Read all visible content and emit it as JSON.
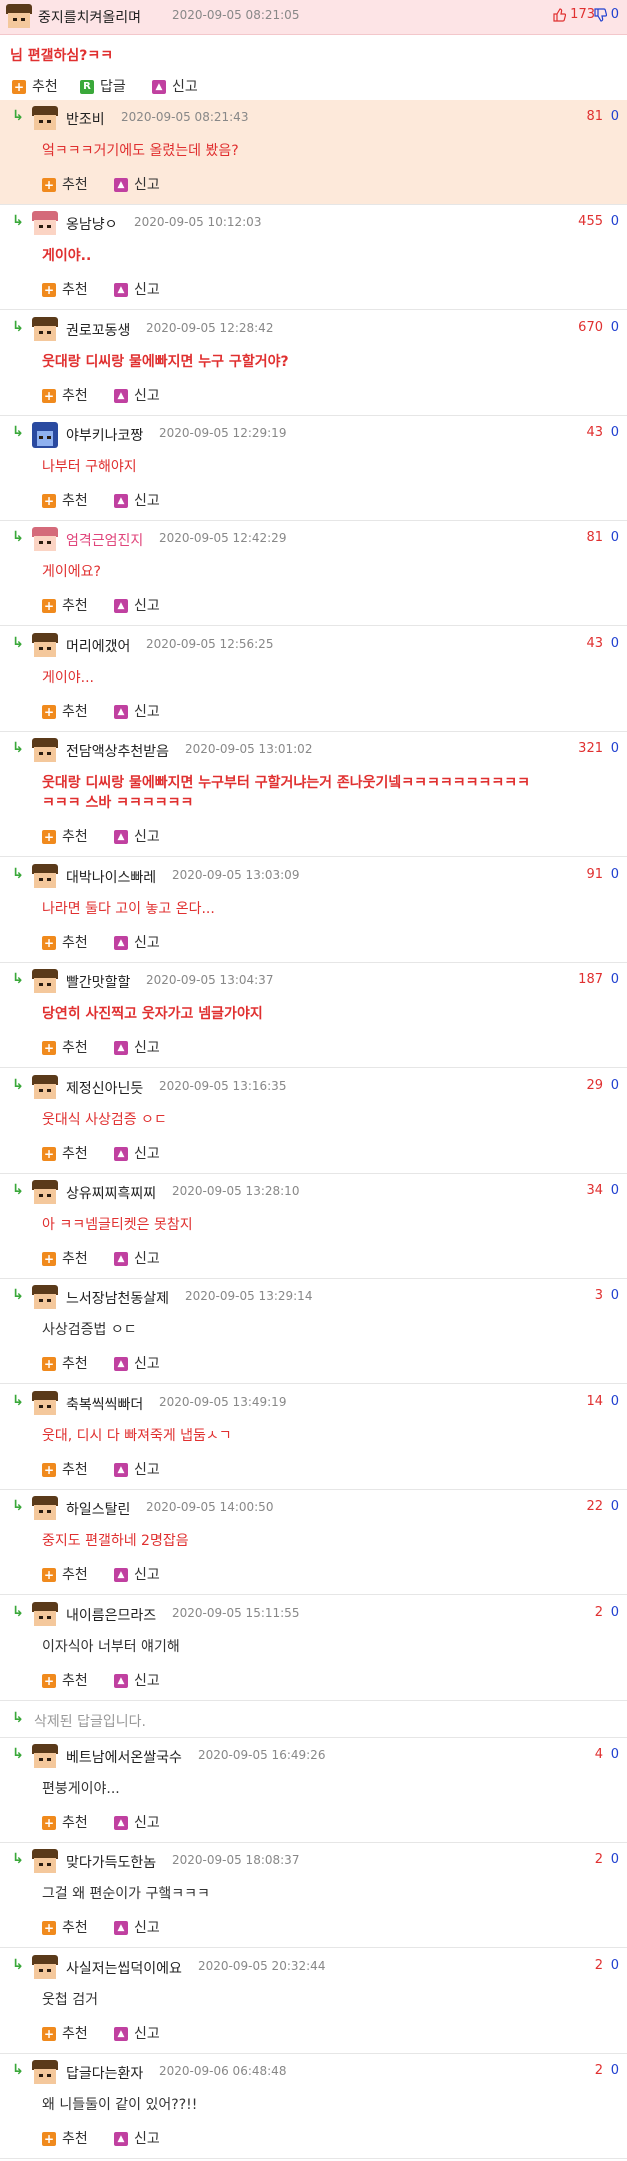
{
  "post": {
    "nick": "중지를치켜올리며",
    "time": "2020-09-05 08:21:05",
    "like_count": "173",
    "dislike_count": "0",
    "text": "님 편갤하심?ㅋㅋ",
    "actions": {
      "recommend": "추천",
      "reply": "답글",
      "report": "신고"
    }
  },
  "comment_actions": {
    "recommend": "추천",
    "report": "신고"
  },
  "comments": [
    {
      "nick": "반조비",
      "time": "2020-09-05 08:21:43",
      "count": "81",
      "zero": "0",
      "text": "엌ㅋㅋㅋ거기에도 올렸는데 봤음?",
      "style": "red"
    },
    {
      "nick": "옹남냥ㅇ",
      "time": "2020-09-05 10:12:03",
      "count": "455",
      "zero": "0",
      "text": "게이야..",
      "style": "redbold"
    },
    {
      "nick": "권로꼬동생",
      "time": "2020-09-05 12:28:42",
      "count": "670",
      "zero": "0",
      "text": "웃대랑 디씨랑 물에빠지면 누구 구할거야?",
      "style": "redbold"
    },
    {
      "nick": "야부키나코짱",
      "time": "2020-09-05 12:29:19",
      "count": "43",
      "zero": "0",
      "text": "나부터 구해야지",
      "style": "red"
    },
    {
      "nick": "엄격근엄진지",
      "time": "2020-09-05 12:42:29",
      "count": "81",
      "zero": "0",
      "text": "게이에요?",
      "style": "red"
    },
    {
      "nick": "머리에갰어",
      "time": "2020-09-05 12:56:25",
      "count": "43",
      "zero": "0",
      "text": "게이야...",
      "style": "red"
    },
    {
      "nick": "전담액상추천받음",
      "time": "2020-09-05 13:01:02",
      "count": "321",
      "zero": "0",
      "text": "웃대랑 디씨랑 물에빠지면 누구부터 구할거냐는거 존나웃기넼ㅋㅋㅋㅋㅋㅋㅋㅋㅋㅋ",
      "text2": "ㅋㅋㅋ 스바 ㅋㅋㅋㅋㅋㅋ",
      "style": "redbold"
    },
    {
      "nick": "대박나이스빠레",
      "time": "2020-09-05 13:03:09",
      "count": "91",
      "zero": "0",
      "text": "나라면 둘다 고이 놓고 온다...",
      "style": "red"
    },
    {
      "nick": "빨간맛할할",
      "time": "2020-09-05 13:04:37",
      "count": "187",
      "zero": "0",
      "text": "당연히 사진찍고 웃자가고 넴글가야지",
      "style": "redbold"
    },
    {
      "nick": "제정신아닌듯",
      "time": "2020-09-05 13:16:35",
      "count": "29",
      "zero": "0",
      "text": "웃대식 사상검증 ㅇㄷ",
      "style": "red"
    },
    {
      "nick": "상유찌찌흑찌찌",
      "time": "2020-09-05 13:28:10",
      "count": "34",
      "zero": "0",
      "text": "아 ㅋㅋ넴글티켓은 못참지",
      "style": "red"
    },
    {
      "nick": "느서장남천동살제",
      "time": "2020-09-05 13:29:14",
      "count": "3",
      "zero": "0",
      "text": "사상검증법 ㅇㄷ",
      "style": "dark"
    },
    {
      "nick": "축복씩씩빠더",
      "time": "2020-09-05 13:49:19",
      "count": "14",
      "zero": "0",
      "text": "웃대, 디시 다 빠져죽게 냅둠ㅅㄱ",
      "style": "red"
    },
    {
      "nick": "하일스탈린",
      "time": "2020-09-05 14:00:50",
      "count": "22",
      "zero": "0",
      "text": "중지도 편갤하네 2명잡음",
      "style": "red"
    },
    {
      "nick": "내이름은므라즈",
      "time": "2020-09-05 15:11:55",
      "count": "2",
      "zero": "0",
      "text": "이자식아 너부터 얘기해",
      "style": "dark"
    }
  ],
  "deleted_reply": "삭제된 답글입니다.",
  "comments2": [
    {
      "nick": "베트남에서온쌀국수",
      "time": "2020-09-05 16:49:26",
      "count": "4",
      "zero": "0",
      "text": "편붕게이야...",
      "style": "dark"
    },
    {
      "nick": "맞다가득도한놈",
      "time": "2020-09-05 18:08:37",
      "count": "2",
      "zero": "0",
      "text": "그걸 왜 편순이가 구햌ㅋㅋㅋ",
      "style": "dark"
    },
    {
      "nick": "사실저는씹덕이에요",
      "time": "2020-09-05 20:32:44",
      "count": "2",
      "zero": "0",
      "text": "웃첩 검거",
      "style": "dark"
    },
    {
      "nick": "답글다는환자",
      "time": "2020-09-06 06:48:48",
      "count": "2",
      "zero": "0",
      "text": "왜 니들둘이 같이 있어??!!",
      "style": "dark"
    }
  ],
  "colors": {
    "accent_red": "#e03030",
    "highlight": "#fde9da",
    "top_bg": "#fde4e6",
    "reply_green": "#3aa83a"
  }
}
